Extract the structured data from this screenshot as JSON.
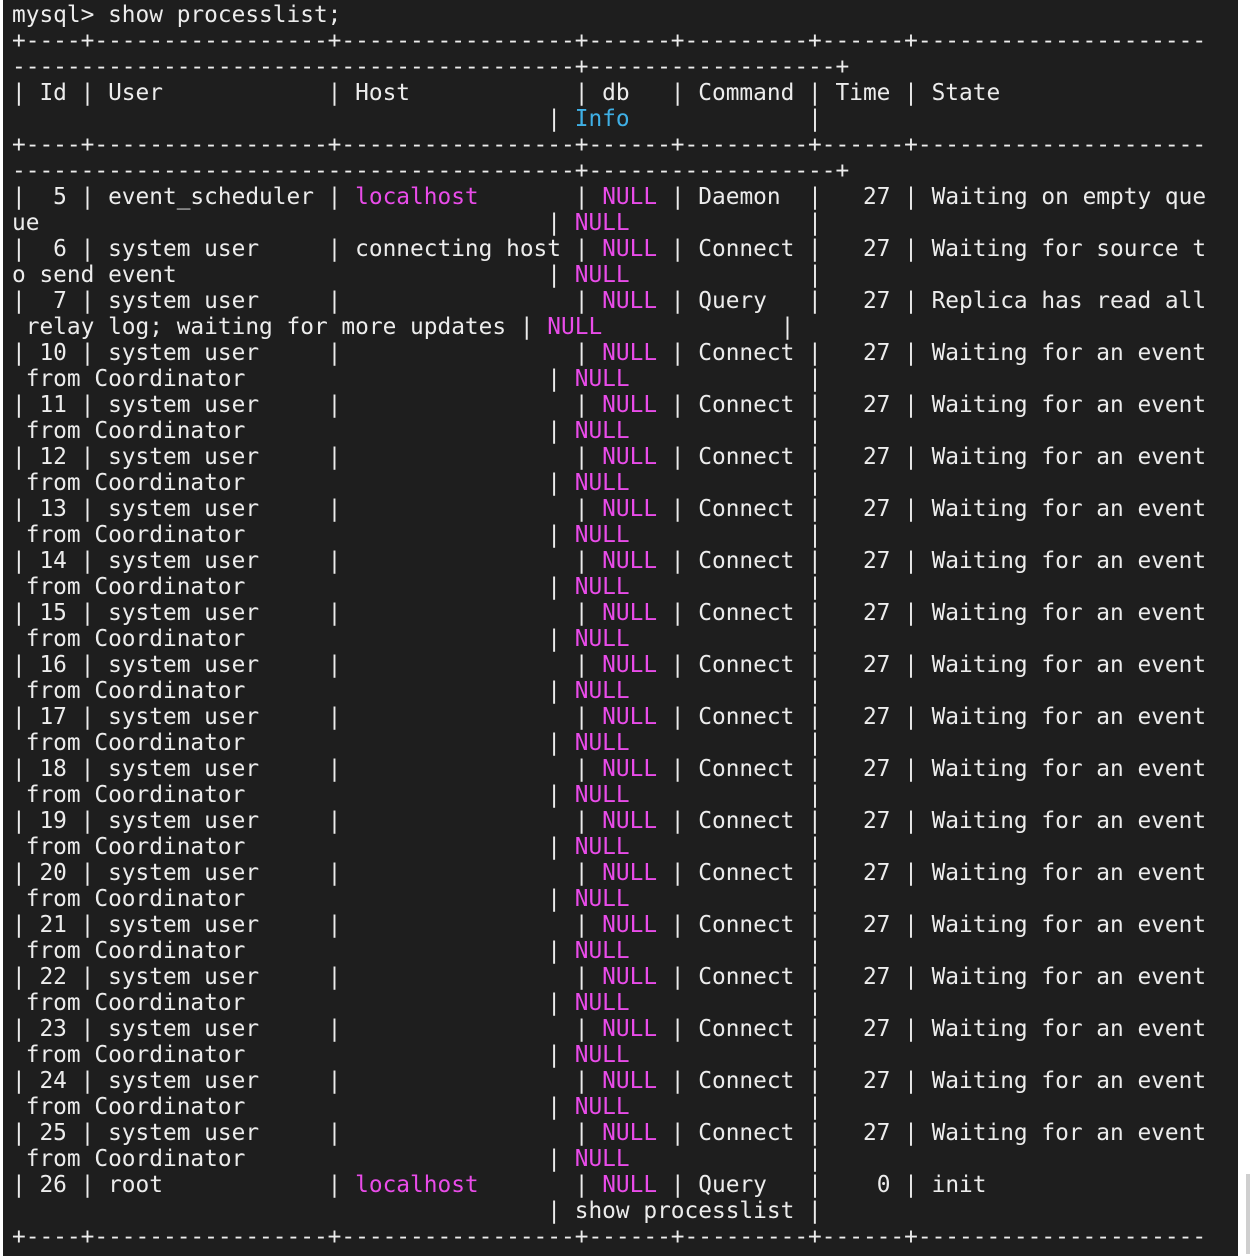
{
  "terminal": {
    "lines": [
      [
        {
          "t": "mysql> show processlist;"
        }
      ],
      [
        {
          "t": "+----+-----------------+-----------------+------+---------+------+---------------------"
        }
      ],
      [
        {
          "t": "-----------------------------------------+------------------+"
        }
      ],
      [
        {
          "t": "| Id | User            | Host            | db   | Command | Time | State"
        }
      ],
      [
        {
          "t": "                                       | "
        },
        {
          "t": "Info",
          "c": "cyan"
        },
        {
          "t": "             |"
        }
      ],
      [
        {
          "t": "+----+-----------------+-----------------+------+---------+------+---------------------"
        }
      ],
      [
        {
          "t": "-----------------------------------------+------------------+"
        }
      ],
      [
        {
          "t": "|  5 | event_scheduler | "
        },
        {
          "t": "localhost",
          "c": "mag"
        },
        {
          "t": "       | "
        },
        {
          "t": "NULL",
          "c": "mag"
        },
        {
          "t": " | Daemon  |   27 | Waiting on empty que"
        }
      ],
      [
        {
          "t": "ue                                     | "
        },
        {
          "t": "NULL",
          "c": "mag"
        },
        {
          "t": "             |"
        }
      ],
      [
        {
          "t": "|  6 | system user     | connecting host | "
        },
        {
          "t": "NULL",
          "c": "mag"
        },
        {
          "t": " | Connect |   27 | Waiting for source t"
        }
      ],
      [
        {
          "t": "o send event                           | "
        },
        {
          "t": "NULL",
          "c": "mag"
        },
        {
          "t": "             |"
        }
      ],
      [
        {
          "t": "|  7 | system user     |                 | "
        },
        {
          "t": "NULL",
          "c": "mag"
        },
        {
          "t": " | Query   |   27 | Replica has read all"
        }
      ],
      [
        {
          "t": " relay log; waiting for more updates | "
        },
        {
          "t": "NULL",
          "c": "mag"
        },
        {
          "t": "             |"
        }
      ],
      [
        {
          "t": "| 10 | system user     |                 | "
        },
        {
          "t": "NULL",
          "c": "mag"
        },
        {
          "t": " | Connect |   27 | Waiting for an event"
        }
      ],
      [
        {
          "t": " from Coordinator                      | "
        },
        {
          "t": "NULL",
          "c": "mag"
        },
        {
          "t": "             |"
        }
      ],
      [
        {
          "t": "| 11 | system user     |                 | "
        },
        {
          "t": "NULL",
          "c": "mag"
        },
        {
          "t": " | Connect |   27 | Waiting for an event"
        }
      ],
      [
        {
          "t": " from Coordinator                      | "
        },
        {
          "t": "NULL",
          "c": "mag"
        },
        {
          "t": "             |"
        }
      ],
      [
        {
          "t": "| 12 | system user     |                 | "
        },
        {
          "t": "NULL",
          "c": "mag"
        },
        {
          "t": " | Connect |   27 | Waiting for an event"
        }
      ],
      [
        {
          "t": " from Coordinator                      | "
        },
        {
          "t": "NULL",
          "c": "mag"
        },
        {
          "t": "             |"
        }
      ],
      [
        {
          "t": "| 13 | system user     |                 | "
        },
        {
          "t": "NULL",
          "c": "mag"
        },
        {
          "t": " | Connect |   27 | Waiting for an event"
        }
      ],
      [
        {
          "t": " from Coordinator                      | "
        },
        {
          "t": "NULL",
          "c": "mag"
        },
        {
          "t": "             |"
        }
      ],
      [
        {
          "t": "| 14 | system user     |                 | "
        },
        {
          "t": "NULL",
          "c": "mag"
        },
        {
          "t": " | Connect |   27 | Waiting for an event"
        }
      ],
      [
        {
          "t": " from Coordinator                      | "
        },
        {
          "t": "NULL",
          "c": "mag"
        },
        {
          "t": "             |"
        }
      ],
      [
        {
          "t": "| 15 | system user     |                 | "
        },
        {
          "t": "NULL",
          "c": "mag"
        },
        {
          "t": " | Connect |   27 | Waiting for an event"
        }
      ],
      [
        {
          "t": " from Coordinator                      | "
        },
        {
          "t": "NULL",
          "c": "mag"
        },
        {
          "t": "             |"
        }
      ],
      [
        {
          "t": "| 16 | system user     |                 | "
        },
        {
          "t": "NULL",
          "c": "mag"
        },
        {
          "t": " | Connect |   27 | Waiting for an event"
        }
      ],
      [
        {
          "t": " from Coordinator                      | "
        },
        {
          "t": "NULL",
          "c": "mag"
        },
        {
          "t": "             |"
        }
      ],
      [
        {
          "t": "| 17 | system user     |                 | "
        },
        {
          "t": "NULL",
          "c": "mag"
        },
        {
          "t": " | Connect |   27 | Waiting for an event"
        }
      ],
      [
        {
          "t": " from Coordinator                      | "
        },
        {
          "t": "NULL",
          "c": "mag"
        },
        {
          "t": "             |"
        }
      ],
      [
        {
          "t": "| 18 | system user     |                 | "
        },
        {
          "t": "NULL",
          "c": "mag"
        },
        {
          "t": " | Connect |   27 | Waiting for an event"
        }
      ],
      [
        {
          "t": " from Coordinator                      | "
        },
        {
          "t": "NULL",
          "c": "mag"
        },
        {
          "t": "             |"
        }
      ],
      [
        {
          "t": "| 19 | system user     |                 | "
        },
        {
          "t": "NULL",
          "c": "mag"
        },
        {
          "t": " | Connect |   27 | Waiting for an event"
        }
      ],
      [
        {
          "t": " from Coordinator                      | "
        },
        {
          "t": "NULL",
          "c": "mag"
        },
        {
          "t": "             |"
        }
      ],
      [
        {
          "t": "| 20 | system user     |                 | "
        },
        {
          "t": "NULL",
          "c": "mag"
        },
        {
          "t": " | Connect |   27 | Waiting for an event"
        }
      ],
      [
        {
          "t": " from Coordinator                      | "
        },
        {
          "t": "NULL",
          "c": "mag"
        },
        {
          "t": "             |"
        }
      ],
      [
        {
          "t": "| 21 | system user     |                 | "
        },
        {
          "t": "NULL",
          "c": "mag"
        },
        {
          "t": " | Connect |   27 | Waiting for an event"
        }
      ],
      [
        {
          "t": " from Coordinator                      | "
        },
        {
          "t": "NULL",
          "c": "mag"
        },
        {
          "t": "             |"
        }
      ],
      [
        {
          "t": "| 22 | system user     |                 | "
        },
        {
          "t": "NULL",
          "c": "mag"
        },
        {
          "t": " | Connect |   27 | Waiting for an event"
        }
      ],
      [
        {
          "t": " from Coordinator                      | "
        },
        {
          "t": "NULL",
          "c": "mag"
        },
        {
          "t": "             |"
        }
      ],
      [
        {
          "t": "| 23 | system user     |                 | "
        },
        {
          "t": "NULL",
          "c": "mag"
        },
        {
          "t": " | Connect |   27 | Waiting for an event"
        }
      ],
      [
        {
          "t": " from Coordinator                      | "
        },
        {
          "t": "NULL",
          "c": "mag"
        },
        {
          "t": "             |"
        }
      ],
      [
        {
          "t": "| 24 | system user     |                 | "
        },
        {
          "t": "NULL",
          "c": "mag"
        },
        {
          "t": " | Connect |   27 | Waiting for an event"
        }
      ],
      [
        {
          "t": " from Coordinator                      | "
        },
        {
          "t": "NULL",
          "c": "mag"
        },
        {
          "t": "             |"
        }
      ],
      [
        {
          "t": "| 25 | system user     |                 | "
        },
        {
          "t": "NULL",
          "c": "mag"
        },
        {
          "t": " | Connect |   27 | Waiting for an event"
        }
      ],
      [
        {
          "t": " from Coordinator                      | "
        },
        {
          "t": "NULL",
          "c": "mag"
        },
        {
          "t": "             |"
        }
      ],
      [
        {
          "t": "| 26 | root            | "
        },
        {
          "t": "localhost",
          "c": "mag"
        },
        {
          "t": "       | "
        },
        {
          "t": "NULL",
          "c": "mag"
        },
        {
          "t": " | Query   |    0 | init"
        }
      ],
      [
        {
          "t": "                                       | show processlist |"
        }
      ],
      [
        {
          "t": "+----+-----------------+-----------------+------+---------+------+---------------------"
        }
      ]
    ]
  },
  "colors": {
    "background": "#1e1e1e",
    "text": "#ececec",
    "null_and_host": "#e94ce9",
    "info_header": "#3fb0e6"
  }
}
